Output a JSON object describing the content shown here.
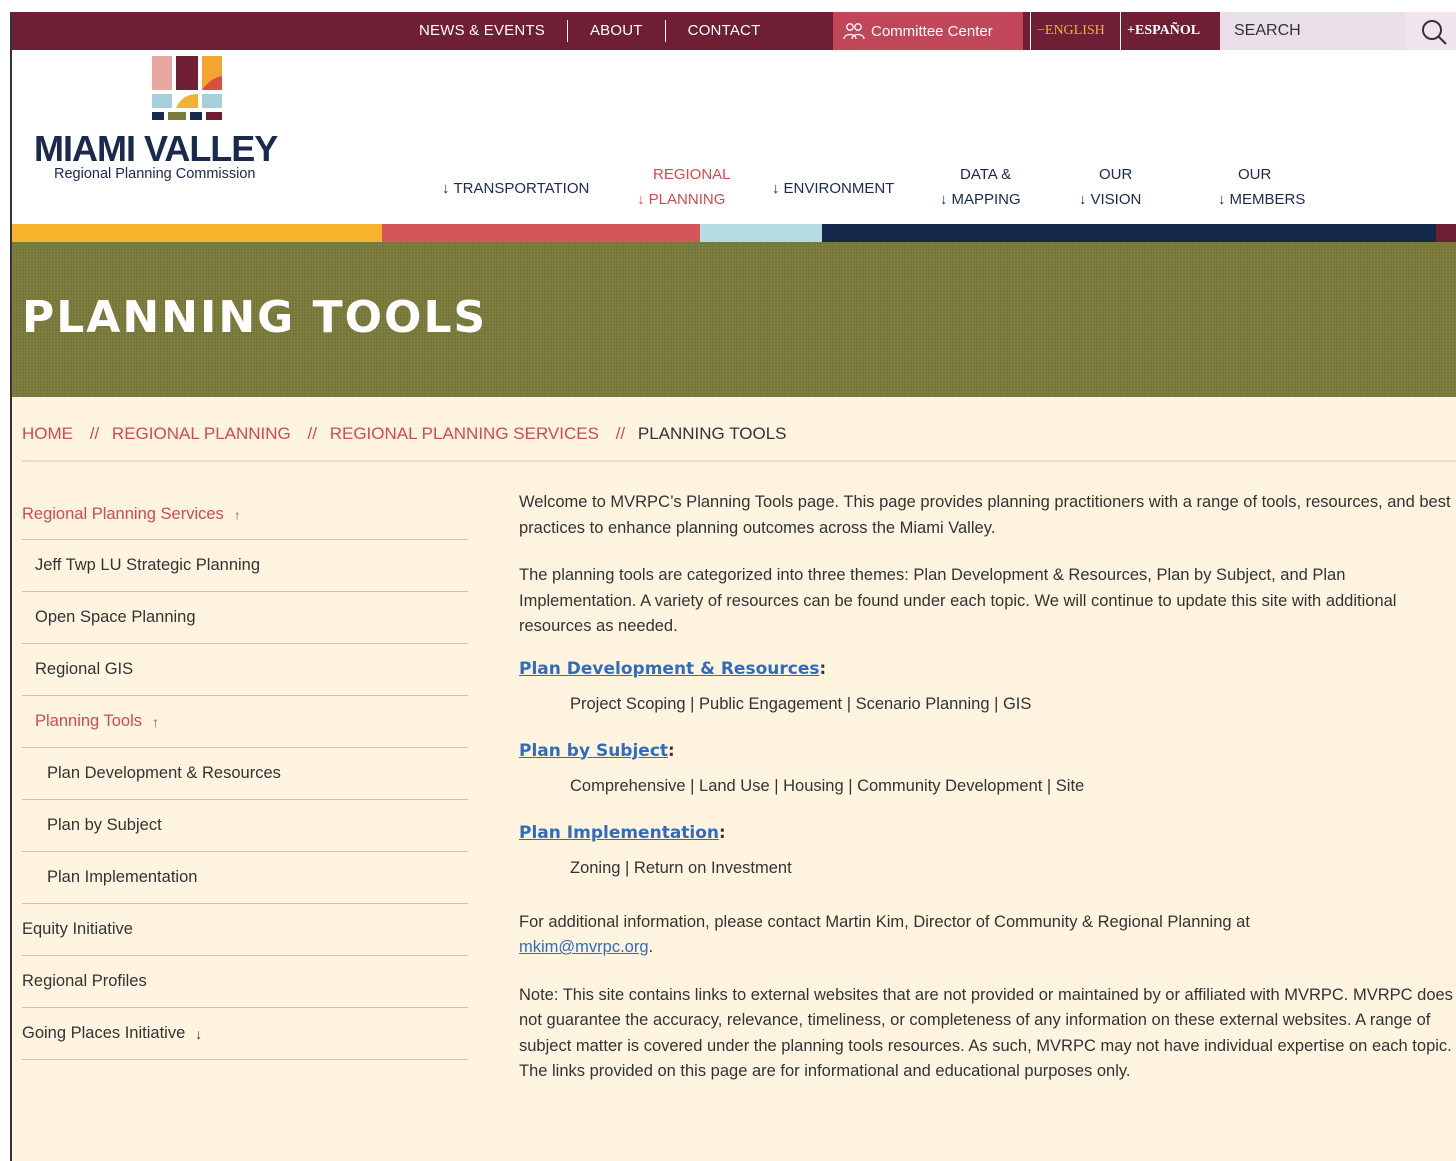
{
  "topbar": {
    "nav": [
      "NEWS & EVENTS",
      "ABOUT",
      "CONTACT"
    ],
    "committee_label": "Committee Center",
    "lang_english": "−ENGLISH",
    "lang_spanish": "+ESPAÑOL",
    "search_placeholder": "SEARCH"
  },
  "logo": {
    "title": "MIAMI VALLEY",
    "subtitle": "Regional Planning Commission"
  },
  "mainnav": [
    {
      "line1": "",
      "line2": "TRANSPORTATION"
    },
    {
      "line1": "REGIONAL",
      "line2": "PLANNING"
    },
    {
      "line1": "",
      "line2": "ENVIRONMENT"
    },
    {
      "line1": "DATA &",
      "line2": "MAPPING"
    },
    {
      "line1": "OUR",
      "line2": "VISION"
    },
    {
      "line1": "OUR",
      "line2": "MEMBERS"
    }
  ],
  "colors": {
    "maroon": "#6e1f33",
    "accent_red": "#d24a4f",
    "navy": "#1a2a4f",
    "olive": "#7a7a3a",
    "stripe_yellow": "#f7b32b",
    "stripe_red": "#d4555a",
    "stripe_blue": "#b7dbe4",
    "stripe_navy": "#14284b",
    "link_blue": "#2f6cc0"
  },
  "hero": {
    "title": "PLANNING TOOLS"
  },
  "breadcrumb": [
    "HOME",
    "REGIONAL PLANNING",
    "REGIONAL PLANNING SERVICES",
    "PLANNING TOOLS"
  ],
  "breadcrumb_sep": "//",
  "sidebar": [
    {
      "label": "Regional Planning Services",
      "arrow": "↑"
    },
    {
      "label": "Jeff Twp LU Strategic Planning"
    },
    {
      "label": "Open Space Planning"
    },
    {
      "label": "Regional GIS"
    },
    {
      "label": "Planning Tools",
      "arrow": "↑"
    },
    {
      "label": "Plan Development & Resources"
    },
    {
      "label": "Plan by Subject"
    },
    {
      "label": "Plan Implementation"
    },
    {
      "label": "Equity Initiative"
    },
    {
      "label": "Regional Profiles"
    },
    {
      "label": "Going Places Initiative",
      "arrow": "↓"
    }
  ],
  "content": {
    "intro": "Welcome to MVRPC’s Planning Tools page. This page provides planning practitioners with a range of tools, resources, and best practices to enhance planning outcomes across the Miami Valley.",
    "themes": "The planning tools are categorized into three themes: Plan Development & Resources, Plan by Subject, and Plan Implementation. A variety of resources can be found under each topic.   We will continue to update this site with additional resources as needed.",
    "sections": [
      {
        "title": "Plan Development & Resources",
        "items": "Project Scoping | Public Engagement | Scenario Planning | GIS"
      },
      {
        "title": "Plan by Subject",
        "items": "Comprehensive | Land Use | Housing | Community Development | Site"
      },
      {
        "title": "Plan Implementation",
        "items": "Zoning | Return on Investment"
      }
    ],
    "contact_text": "For additional information, please contact Martin Kim, Director of Community & Regional Planning at",
    "contact_email": "mkim@mvrpc.org",
    "note": "Note: This site contains links to external websites that are not provided or maintained by or affiliated with MVRPC. MVRPC does not guarantee the accuracy, relevance, timeliness, or completeness of any information on these external websites. A range of subject matter is covered under the planning tools resources. As such, MVRPC may not have individual expertise on each topic. The links provided on this page are for informational and educational purposes only."
  }
}
